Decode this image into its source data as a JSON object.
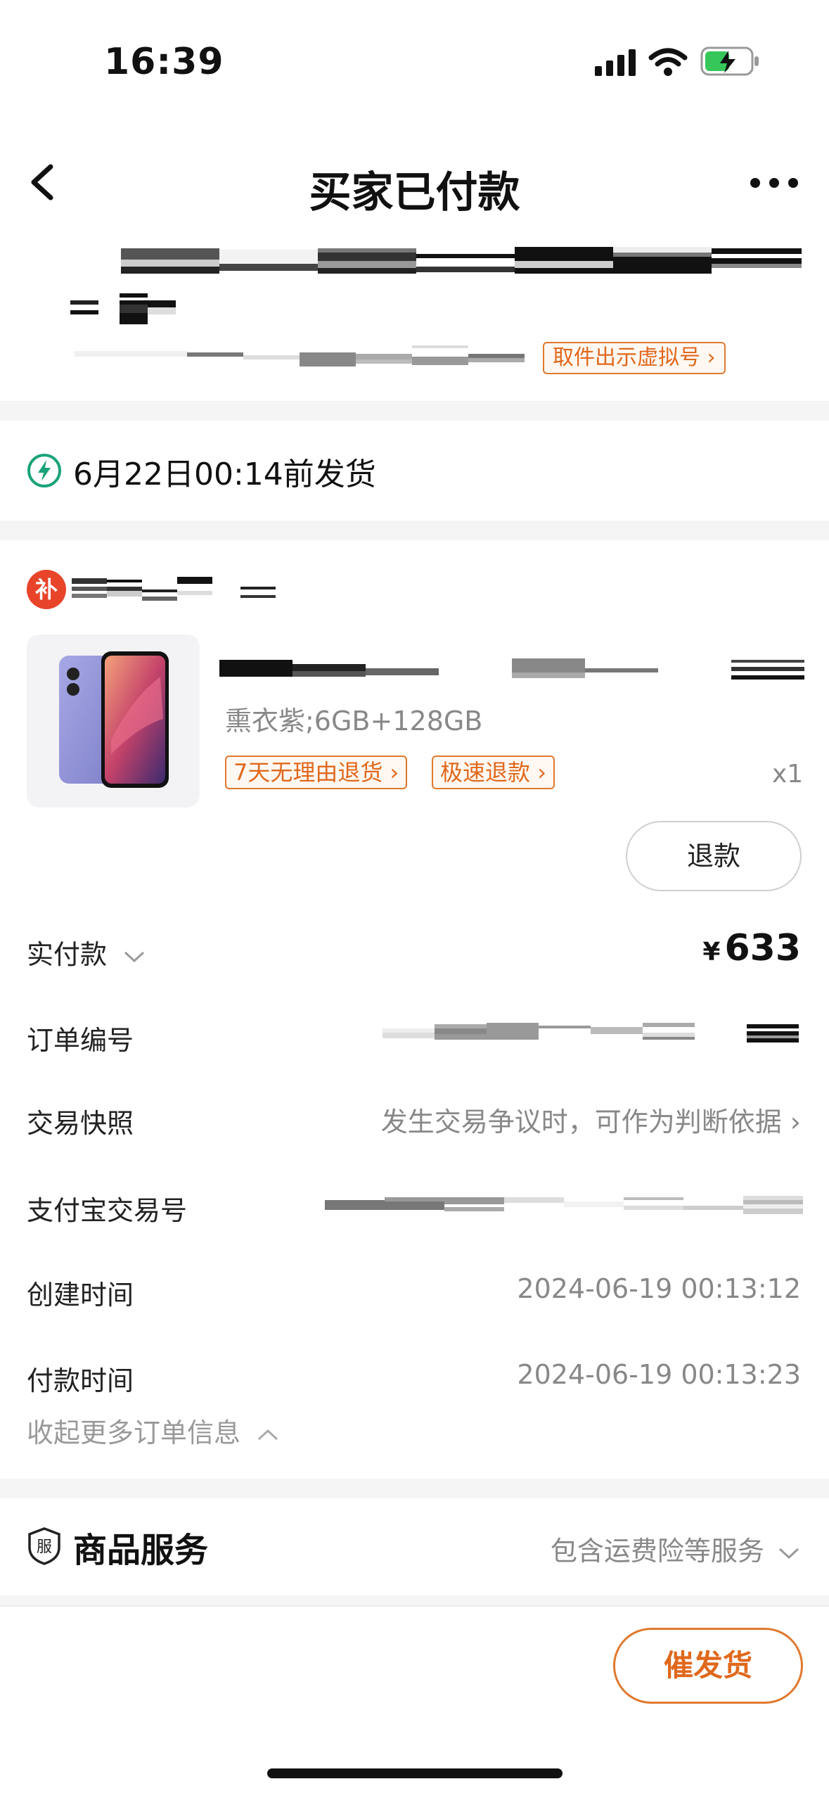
{
  "status_bar": {
    "time": "16:39"
  },
  "nav": {
    "title": "买家已付款"
  },
  "address": {
    "pickup_button": "取件出示虚拟号"
  },
  "shipping": {
    "deadline_text": "6月22日00:14前发货"
  },
  "shop": {
    "icon_char": "补"
  },
  "product": {
    "variant": "熏衣紫;6GB+128GB",
    "tags": [
      "7天无理由退货",
      "极速退款"
    ],
    "quantity": "x1",
    "refund_button": "退款"
  },
  "order_info": {
    "paid_label": "实付款",
    "currency": "¥",
    "paid_amount": "633",
    "order_no_label": "订单编号",
    "snapshot_label": "交易快照",
    "snapshot_value": "发生交易争议时，可作为判断依据",
    "alipay_label": "支付宝交易号",
    "created_label": "创建时间",
    "created_value": "2024-06-19 00:13:12",
    "paid_time_label": "付款时间",
    "paid_time_value": "2024-06-19 00:13:23",
    "collapse_label": "收起更多订单信息"
  },
  "service": {
    "icon_char": "服",
    "title": "商品服务",
    "value": "包含运费险等服务"
  },
  "bottom": {
    "urge_button": "催发货"
  },
  "colors": {
    "accent": "#e0681c",
    "shop_red": "#e8442a",
    "bolt_green": "#1aa37a"
  }
}
